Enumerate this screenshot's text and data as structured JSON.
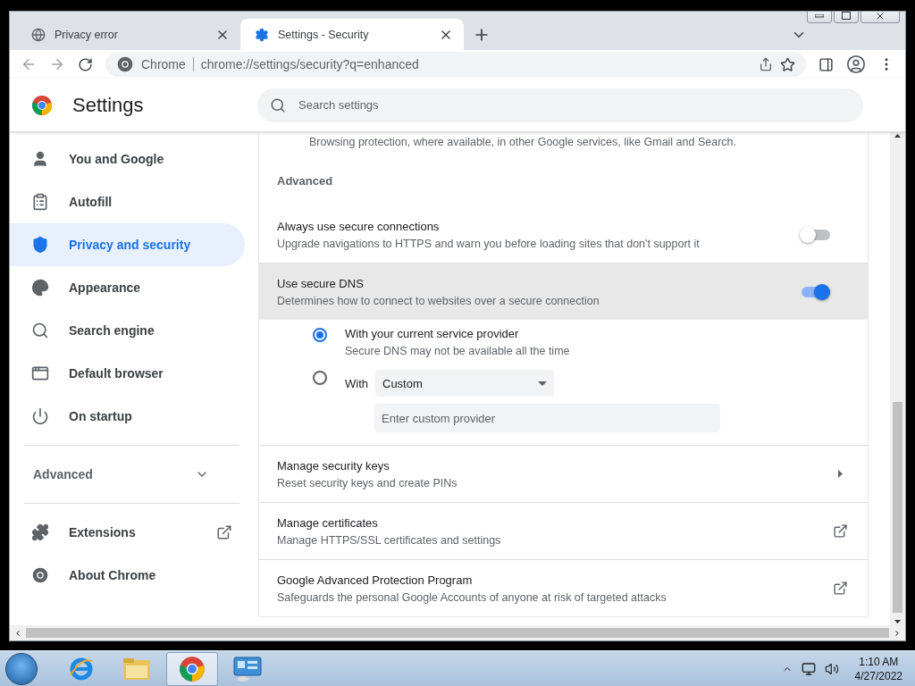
{
  "tabs": [
    {
      "title": "Privacy error",
      "selected": false
    },
    {
      "title": "Settings - Security",
      "selected": true
    }
  ],
  "omnibox": {
    "site_label": "Chrome",
    "url": "chrome://settings/security?q=enhanced"
  },
  "settings_header": {
    "title": "Settings",
    "search_placeholder": "Search settings"
  },
  "sidebar": {
    "items": [
      {
        "label": "You and Google",
        "kind": "person",
        "selected": false
      },
      {
        "label": "Autofill",
        "kind": "clipboard",
        "selected": false
      },
      {
        "label": "Privacy and security",
        "kind": "shield",
        "selected": true
      },
      {
        "label": "Appearance",
        "kind": "palette",
        "selected": false
      },
      {
        "label": "Search engine",
        "kind": "search",
        "selected": false
      },
      {
        "label": "Default browser",
        "kind": "browser",
        "selected": false
      },
      {
        "label": "On startup",
        "kind": "power",
        "selected": false
      }
    ],
    "advanced": {
      "label": "Advanced",
      "expanded": false
    },
    "footer": [
      {
        "label": "Extensions",
        "kind": "puzzle",
        "external": true
      },
      {
        "label": "About Chrome",
        "kind": "chrome",
        "external": false
      }
    ]
  },
  "content": {
    "cut_text": "Browsing protection, where available, in other Google services, like Gmail and Search.",
    "section_title": "Advanced",
    "toggles": [
      {
        "title": "Always use secure connections",
        "description": "Upgrade navigations to HTTPS and warn you before loading sites that don't support it",
        "on": false,
        "highlighted": false
      },
      {
        "title": "Use secure DNS",
        "description": "Determines how to connect to websites over a secure connection",
        "on": true,
        "highlighted": true
      }
    ],
    "dns_options": [
      {
        "kind": "plain",
        "label": "With your current service provider",
        "description": "Secure DNS may not be available all the time",
        "selected": true
      },
      {
        "kind": "custom",
        "label": "With",
        "select_value": "Custom",
        "input_placeholder": "Enter custom provider",
        "selected": false
      }
    ],
    "links": [
      {
        "title": "Manage security keys",
        "description": "Reset security keys and create PINs",
        "kind": "arrow"
      },
      {
        "title": "Manage certificates",
        "description": "Manage HTTPS/SSL certificates and settings",
        "kind": "external"
      },
      {
        "title": "Google Advanced Protection Program",
        "description": "Safeguards the personal Google Accounts of anyone at risk of targeted attacks",
        "kind": "external"
      }
    ]
  },
  "taskbar": {
    "apps": [
      {
        "kind": "ie",
        "active": false
      },
      {
        "kind": "folder",
        "active": false
      },
      {
        "kind": "chrome",
        "active": true
      },
      {
        "kind": "control-panel",
        "active": false
      }
    ],
    "time": "1:10 AM",
    "date": "4/27/2022"
  }
}
